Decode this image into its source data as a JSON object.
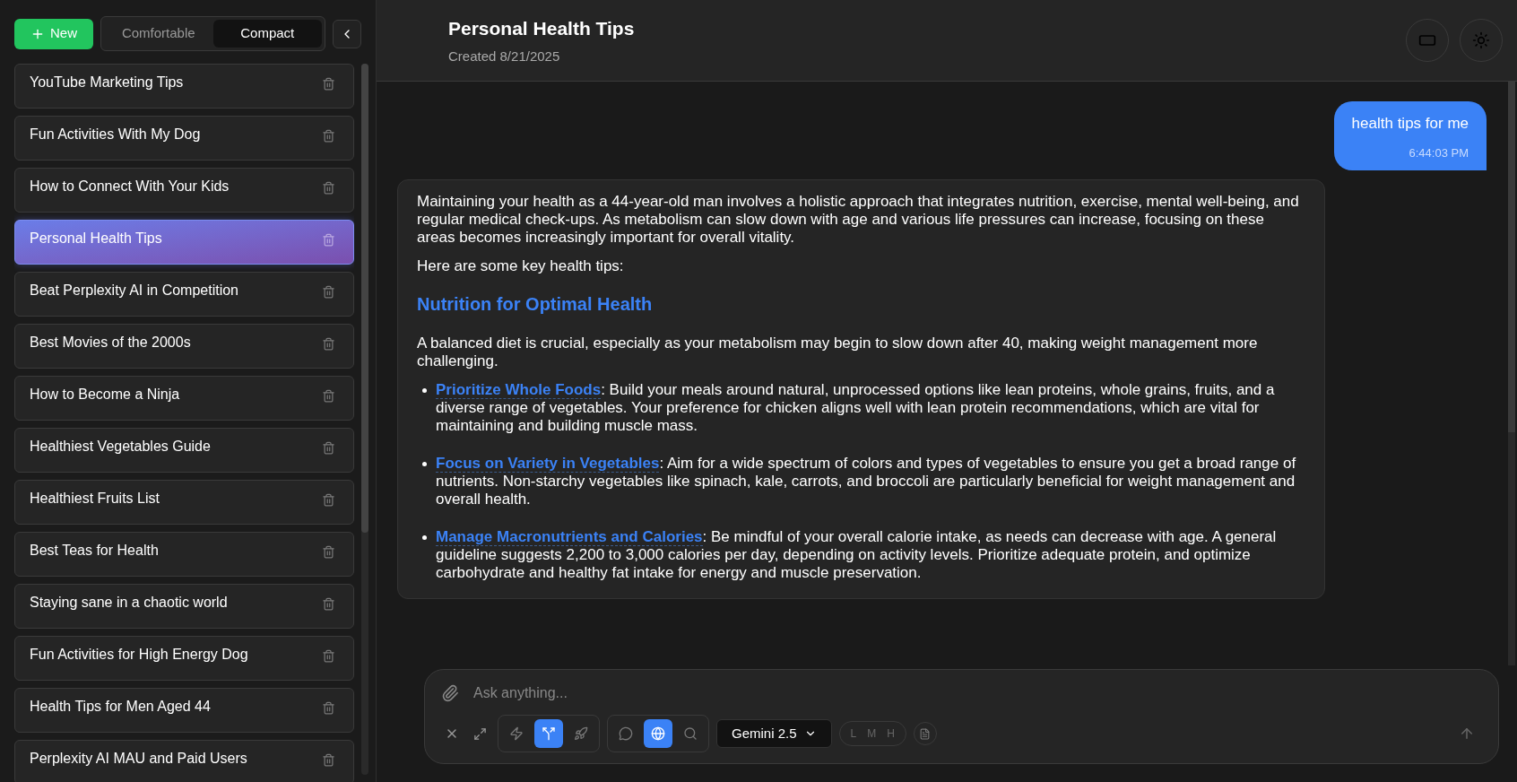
{
  "sidebar": {
    "new_button": {
      "label": "New"
    },
    "density": [
      {
        "label": "Comfortable",
        "selected": false
      },
      {
        "label": "Compact",
        "selected": true
      }
    ],
    "items": [
      {
        "title": "YouTube Marketing Tips",
        "selected": false
      },
      {
        "title": "Fun Activities With My Dog",
        "selected": false
      },
      {
        "title": "How to Connect With Your Kids",
        "selected": false
      },
      {
        "title": "Personal Health Tips",
        "selected": true
      },
      {
        "title": "Beat Perplexity AI in Competition",
        "selected": false
      },
      {
        "title": "Best Movies of the 2000s",
        "selected": false
      },
      {
        "title": "How to Become a Ninja",
        "selected": false
      },
      {
        "title": "Healthiest Vegetables Guide",
        "selected": false
      },
      {
        "title": "Healthiest Fruits List",
        "selected": false
      },
      {
        "title": "Best Teas for Health",
        "selected": false
      },
      {
        "title": "Staying sane in a chaotic world",
        "selected": false
      },
      {
        "title": "Fun Activities for High Energy Dog",
        "selected": false
      },
      {
        "title": "Health Tips for Men Aged 44",
        "selected": false
      },
      {
        "title": "Perplexity AI MAU and Paid Users",
        "selected": false
      }
    ]
  },
  "header": {
    "title": "Personal Health Tips",
    "subtitle": "Created 8/21/2025"
  },
  "messages": [
    {
      "kind": "user",
      "text": "health tips for me",
      "time": "6:44:03 PM"
    },
    {
      "kind": "assistant",
      "blocks": [
        {
          "kind": "paragraph",
          "text": "Maintaining your health as a 44-year-old man involves a holistic approach that integrates nutrition, exercise, mental well-being, and regular medical check-ups. As metabolism can slow down with age and various life pressures can increase, focusing on these areas becomes increasingly important for overall vitality."
        },
        {
          "kind": "paragraph",
          "text": "Here are some key health tips:"
        },
        {
          "kind": "heading",
          "text": "Nutrition for Optimal Health"
        },
        {
          "kind": "paragraph",
          "text": "A balanced diet is crucial, especially as your metabolism may begin to slow down after 40, making weight management more challenging."
        },
        {
          "kind": "bullet",
          "title": "Prioritize Whole Foods",
          "text": ": Build your meals around natural, unprocessed options like lean proteins, whole grains, fruits, and a diverse range of vegetables. Your preference for chicken aligns well with lean protein recommendations, which are vital for maintaining and building muscle mass."
        },
        {
          "kind": "bullet",
          "title": "Focus on Variety in Vegetables",
          "text": ": Aim for a wide spectrum of colors and types of vegetables to ensure you get a broad range of nutrients. Non-starchy vegetables like spinach, kale, carrots, and broccoli are particularly beneficial for weight management and overall health."
        },
        {
          "kind": "bullet",
          "title": "Manage Macronutrients and Calories",
          "text": ": Be mindful of your overall calorie intake, as needs can decrease with age. A general guideline suggests 2,200 to 3,000 calories per day, depending on activity levels. Prioritize adequate protein, and optimize carbohydrate and healthy fat intake for energy and muscle preservation."
        }
      ]
    }
  ],
  "composer": {
    "placeholder": "Ask anything...",
    "modes": [
      {
        "kind": "zap",
        "selected": false
      },
      {
        "kind": "split",
        "selected": true
      },
      {
        "kind": "rocket",
        "selected": false
      }
    ],
    "sources": [
      {
        "kind": "chat",
        "selected": false
      },
      {
        "kind": "web",
        "selected": true
      },
      {
        "kind": "search",
        "selected": false
      }
    ],
    "model": "Gemini 2.5",
    "effort": {
      "disabled": true,
      "levels": [
        "L",
        "M",
        "H"
      ]
    }
  }
}
